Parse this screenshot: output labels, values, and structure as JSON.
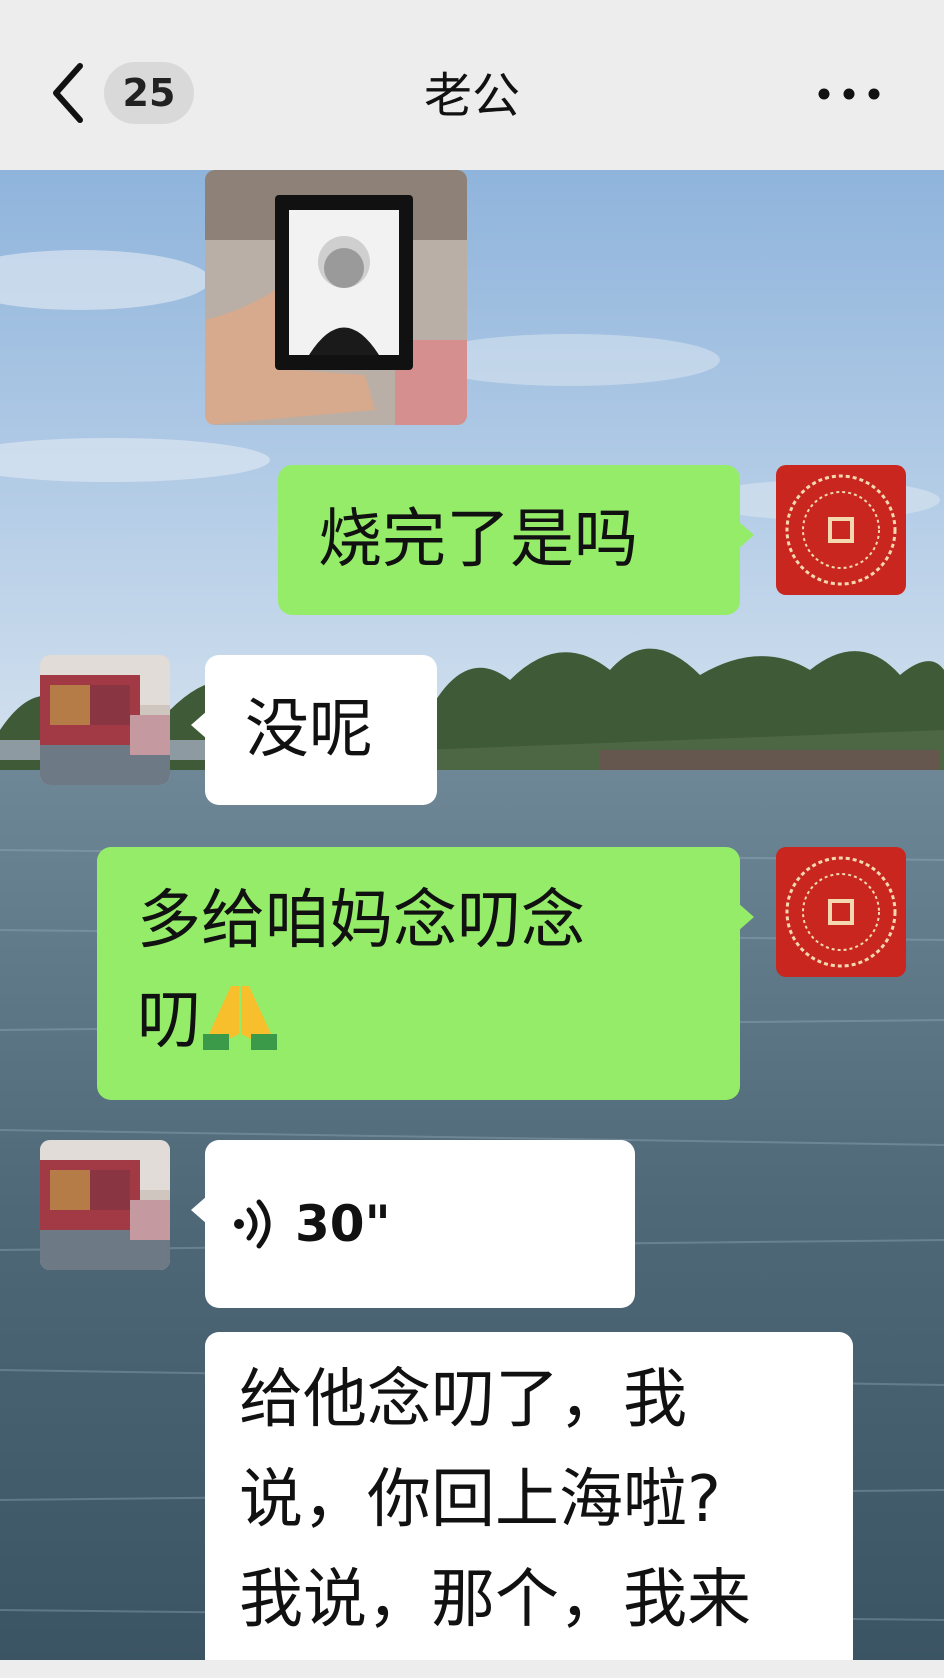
{
  "header": {
    "title": "老公",
    "unread_count": "25",
    "back_icon": "chevron-left-icon",
    "more_icon": "ellipsis-icon"
  },
  "messages": [
    {
      "type": "image",
      "from": "me",
      "description_icon": "photo-frame-image"
    },
    {
      "type": "text",
      "from": "me",
      "text": "烧完了是吗"
    },
    {
      "type": "text",
      "from": "other",
      "text": "没呢"
    },
    {
      "type": "text",
      "from": "me",
      "text_line1": "多给咱妈念叨念",
      "text_line2": "叨",
      "emoji": "folded-hands-emoji"
    },
    {
      "type": "voice",
      "from": "other",
      "duration": "30\"",
      "icon": "voice-wave-icon"
    },
    {
      "type": "text",
      "from": "other",
      "lines": [
        "给他念叨了，我",
        "说，你回上海啦?",
        "我说，那个，我来"
      ]
    }
  ],
  "colors": {
    "sent_bubble": "#95ec69",
    "recv_bubble": "#ffffff",
    "header_bg": "#ededed",
    "self_avatar": "#c8261e"
  }
}
